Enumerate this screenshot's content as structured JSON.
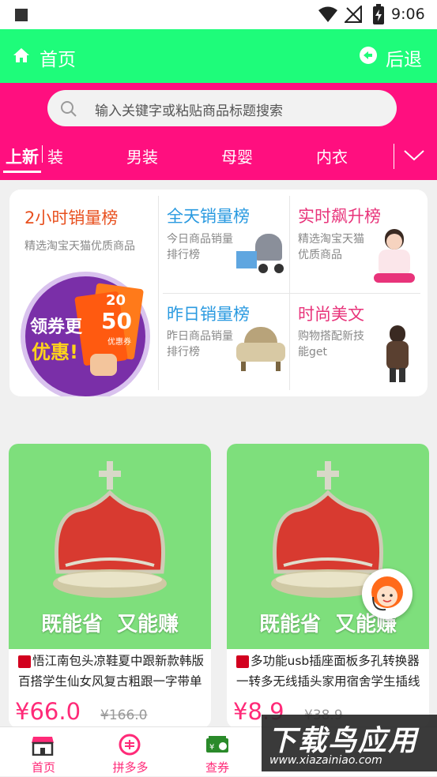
{
  "status": {
    "time": "9:06"
  },
  "appbar": {
    "title": "首页",
    "back_label": "后退"
  },
  "search": {
    "placeholder": "输入关键字或粘贴商品标题搜索"
  },
  "tabs": [
    {
      "label": "上新",
      "active": true
    },
    {
      "label": "装"
    },
    {
      "label": "男装"
    },
    {
      "label": "母婴"
    },
    {
      "label": "内衣"
    }
  ],
  "ranking": {
    "hot2h": {
      "title": "2小时销量榜",
      "subtitle": "精选淘宝天猫优质商品",
      "promo_text_1": "领券更",
      "promo_text_2": "优惠!",
      "coupon_value": "50",
      "coupon_value_small": "20",
      "coupon_small": "优惠券"
    },
    "allday": {
      "title": "全天销量榜",
      "subtitle": "今日商品销量排行榜"
    },
    "realtime": {
      "title": "实时飙升榜",
      "subtitle": "精选淘宝天猫优质商品"
    },
    "yesterday": {
      "title": "昨日销量榜",
      "subtitle": "昨日商品销量排行榜"
    },
    "fashion": {
      "title": "时尚美文",
      "subtitle": "购物搭配新技能get"
    }
  },
  "products": [
    {
      "banner": "既能省  又能赚",
      "title": "悟江南包头凉鞋夏中跟新款韩版百搭学生仙女风复古粗跟一字带单",
      "price": "¥66.0",
      "old_price": "¥166.0"
    },
    {
      "banner": "既能省  又能赚",
      "title": "多功能usb插座面板多孔转换器一转多无线插头家用宿舍学生插线",
      "price": "¥8.9",
      "old_price": "¥38.9"
    }
  ],
  "bottom_nav": [
    {
      "label": "首页",
      "icon": "store-icon"
    },
    {
      "label": "拼多多",
      "icon": "pinduoduo-icon"
    },
    {
      "label": "查券",
      "icon": "coupon-icon"
    },
    {
      "label": "",
      "icon": "unknown-icon"
    },
    {
      "label": "",
      "icon": "unknown-icon"
    }
  ],
  "watermark": {
    "text_cn": "下载鸟应用",
    "text_en": "www.xiazainiao.com"
  },
  "colors": {
    "appbar": "#1efc7a",
    "accent": "#ff0f7f",
    "price": "#ff2a78",
    "card_green": "#7edf7c"
  }
}
